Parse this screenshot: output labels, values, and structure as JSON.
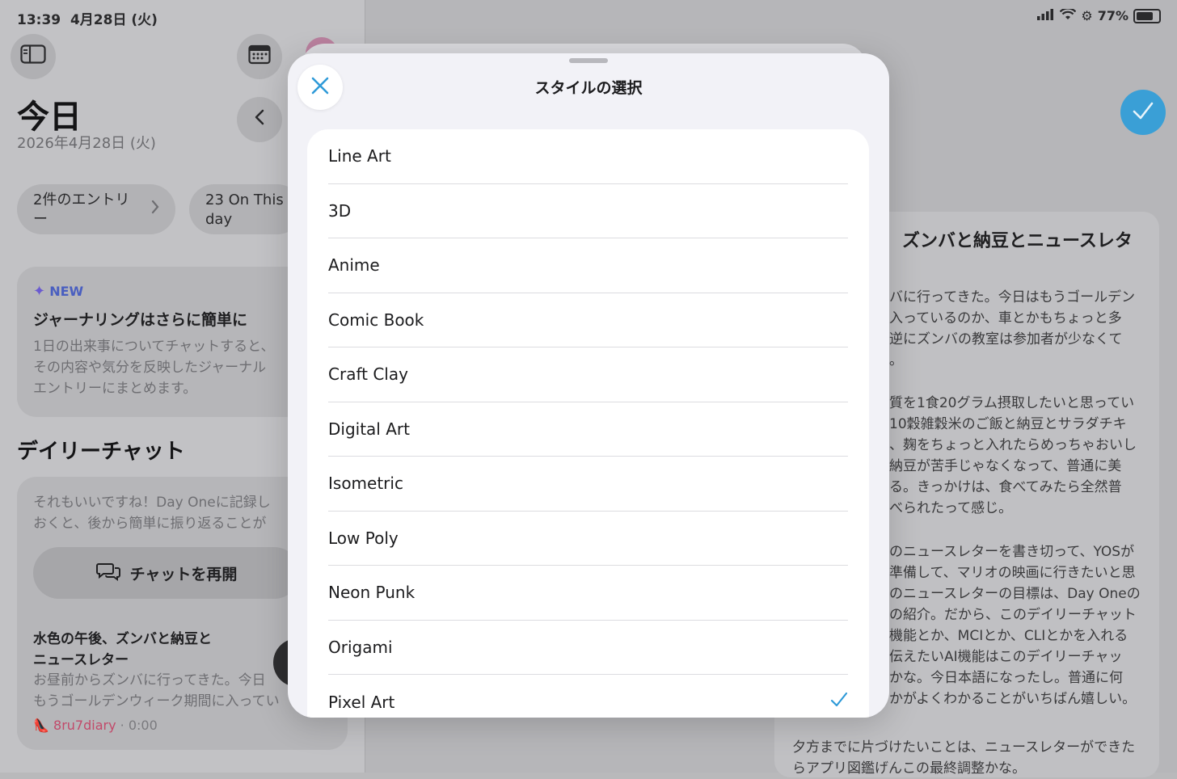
{
  "status": {
    "time": "13:39",
    "date": "4月28日 (火)",
    "battery": "77%"
  },
  "left": {
    "title": "今日",
    "date": "2026年4月28日 (火)",
    "entries_pill": "2件のエントリー",
    "on_this_day_pill": "23 On This day",
    "promo": {
      "badge": "NEW",
      "title": "ジャーナリングはさらに簡単に",
      "body_lines": [
        "1日の出来事についてチャットすると、",
        "その内容や気分を反映したジャーナル",
        "エントリーにまとめます。"
      ]
    },
    "daily_chat_title": "デイリーチャット",
    "chat_message_lines": [
      "それもいいですね！Day Oneに記録し",
      "おくと、後から簡単に振り返ることが"
    ],
    "resume_button": "チャットを再開",
    "entry_title_lines": [
      "水色の午後、ズンバと納豆と",
      "ニュースレター"
    ],
    "entry_body_lines": [
      "お昼前からズンバに行ってきた。今日",
      "もうゴールデンウィーク期間に入ってい"
    ],
    "entry_journal": "8ru7diary",
    "entry_time": "0:00"
  },
  "article": {
    "title": "ズンバと納豆とニュースレタ",
    "paragraphs": [
      [
        "バに行ってきた。今日はもうゴールデン",
        "入っているのか、車とかもちょっと多",
        "逆にズンバの教室は参加者が少なくて",
        "。"
      ],
      [
        "質を1食20グラム摂取したいと思ってい",
        "10穀雑穀米のご飯と納豆とサラダチキ",
        "、麹をちょっと入れたらめっちゃおいし",
        "納豆が苦手じゃなくなって、普通に美",
        "る。きっかけは、食べてみたら全然普",
        "べられたって感じ。"
      ],
      [
        "のニュースレターを書き切って、YOSが",
        "準備して、マリオの映画に行きたいと思",
        "のニュースレターの目標は、Day Oneの",
        "の紹介。だから、このデイリーチャット",
        "機能とか、MCIとか、CLIとかを入れる",
        "伝えたいAI機能はこのデイリーチャッ",
        "かな。今日本語になったし。普通に何",
        "かがよくわかることがいちばん嬉しい。"
      ]
    ],
    "last_lines": [
      "夕方までに片づけたいことは、ニュースレターができた",
      "らアプリ図鑑げんこの最終調整かな。"
    ]
  },
  "sheet": {
    "title": "スタイルの選択",
    "items": [
      {
        "label": "Line Art",
        "selected": false
      },
      {
        "label": "3D",
        "selected": false
      },
      {
        "label": "Anime",
        "selected": false
      },
      {
        "label": "Comic Book",
        "selected": false
      },
      {
        "label": "Craft Clay",
        "selected": false
      },
      {
        "label": "Digital Art",
        "selected": false
      },
      {
        "label": "Isometric",
        "selected": false
      },
      {
        "label": "Low Poly",
        "selected": false
      },
      {
        "label": "Neon Punk",
        "selected": false
      },
      {
        "label": "Origami",
        "selected": false
      },
      {
        "label": "Pixel Art",
        "selected": true
      }
    ]
  },
  "colors": {
    "accent": "#2f9ad8",
    "sheet_bg": "#f2f2f7",
    "list_bg": "#ffffff"
  },
  "icons": [
    "sidebar-icon",
    "calendar-icon",
    "chevron-left-icon",
    "chevron-right-icon",
    "sparkle-icon",
    "chat-icon",
    "close-icon",
    "checkmark-icon",
    "wifi-icon",
    "signal-icon",
    "battery-icon"
  ]
}
